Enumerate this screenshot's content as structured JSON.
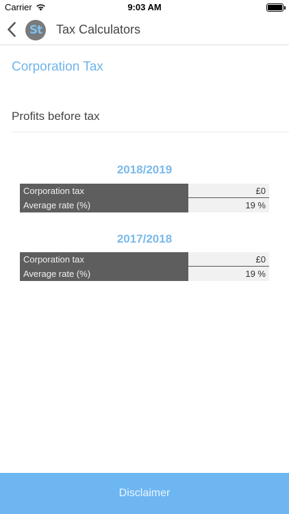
{
  "status": {
    "carrier": "Carrier",
    "time": "9:03 AM"
  },
  "nav": {
    "logo_text": "St",
    "title": "Tax Calculators"
  },
  "section_title": "Corporation Tax",
  "profits_input": {
    "placeholder": "Profits before tax",
    "value": ""
  },
  "years": [
    {
      "title": "2018/2019",
      "rows": [
        {
          "label": "Corporation tax",
          "value": "£0"
        },
        {
          "label": "Average rate (%)",
          "value": "19 %"
        }
      ]
    },
    {
      "title": "2017/2018",
      "rows": [
        {
          "label": "Corporation tax",
          "value": "£0"
        },
        {
          "label": "Average rate (%)",
          "value": "19 %"
        }
      ]
    }
  ],
  "disclaimer_label": "Disclaimer",
  "colors": {
    "accent": "#6fb5ec",
    "disclaimer_bg": "#6db6f2",
    "table_label_bg": "#5e5e5e",
    "table_value_bg": "#f1f1f1"
  },
  "icons": {
    "back": "chevron-left-icon",
    "wifi": "wifi-icon",
    "battery": "battery-icon"
  }
}
